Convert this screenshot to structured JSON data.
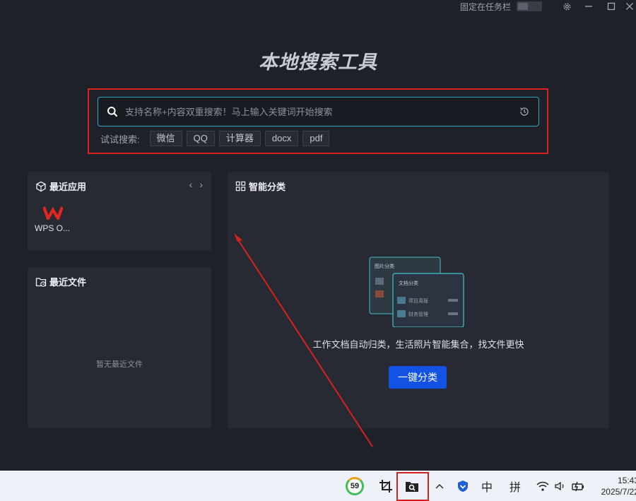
{
  "titlebar": {
    "pin_label": "固定在任务栏",
    "icons": [
      "settings-icon",
      "minimize-icon",
      "maximize-icon",
      "close-icon"
    ]
  },
  "app_title": "本地搜索工具",
  "search": {
    "placeholder": "支持名称+内容双重搜索！马上输入关键词开始搜索",
    "try_label": "试试搜索:",
    "tags": [
      "微信",
      "QQ",
      "计算器",
      "docx",
      "pdf"
    ]
  },
  "recent_apps": {
    "title": "最近应用",
    "apps": [
      {
        "name": "WPS O..."
      }
    ]
  },
  "recent_files": {
    "title": "最近文件",
    "empty_text": "暂无最近文件"
  },
  "smart_classify": {
    "title": "智能分类",
    "illustration": {
      "back_card_title": "图片分类",
      "front_card_title": "文档分类",
      "row1": "项目周报",
      "row2": "财务管理"
    },
    "description": "工作文档自动归类，生活照片智能集合，找文件更快",
    "button_label": "一键分类"
  },
  "taskbar": {
    "badge_value": "59",
    "ime_lang": "中",
    "ime_mode": "拼",
    "time": "15:43",
    "date": "2025/7/22"
  },
  "colors": {
    "background": "#1f2129",
    "panel": "#282a33",
    "accent_button": "#1452e4",
    "search_border": "#2ea6c7",
    "annotation_red": "#d8201e"
  }
}
